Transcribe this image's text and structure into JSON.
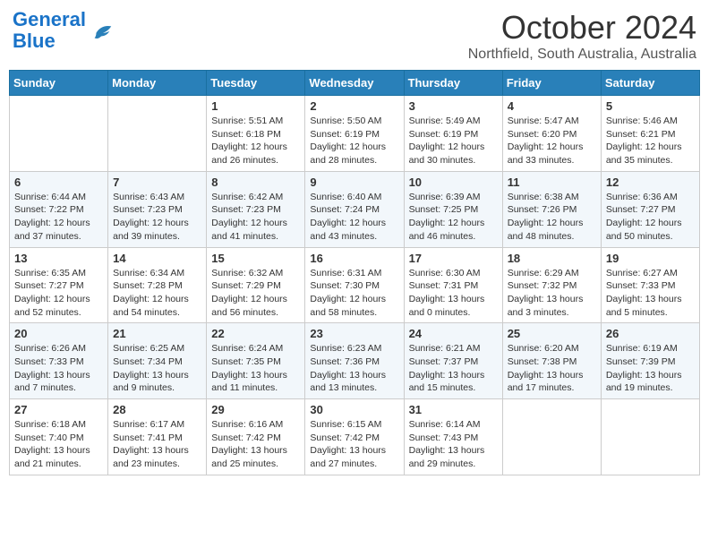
{
  "header": {
    "logo_line1": "General",
    "logo_line2": "Blue",
    "month": "October 2024",
    "location": "Northfield, South Australia, Australia"
  },
  "days_of_week": [
    "Sunday",
    "Monday",
    "Tuesday",
    "Wednesday",
    "Thursday",
    "Friday",
    "Saturday"
  ],
  "weeks": [
    [
      {
        "day": "",
        "info": ""
      },
      {
        "day": "",
        "info": ""
      },
      {
        "day": "1",
        "info": "Sunrise: 5:51 AM\nSunset: 6:18 PM\nDaylight: 12 hours and 26 minutes."
      },
      {
        "day": "2",
        "info": "Sunrise: 5:50 AM\nSunset: 6:19 PM\nDaylight: 12 hours and 28 minutes."
      },
      {
        "day": "3",
        "info": "Sunrise: 5:49 AM\nSunset: 6:19 PM\nDaylight: 12 hours and 30 minutes."
      },
      {
        "day": "4",
        "info": "Sunrise: 5:47 AM\nSunset: 6:20 PM\nDaylight: 12 hours and 33 minutes."
      },
      {
        "day": "5",
        "info": "Sunrise: 5:46 AM\nSunset: 6:21 PM\nDaylight: 12 hours and 35 minutes."
      }
    ],
    [
      {
        "day": "6",
        "info": "Sunrise: 6:44 AM\nSunset: 7:22 PM\nDaylight: 12 hours and 37 minutes."
      },
      {
        "day": "7",
        "info": "Sunrise: 6:43 AM\nSunset: 7:23 PM\nDaylight: 12 hours and 39 minutes."
      },
      {
        "day": "8",
        "info": "Sunrise: 6:42 AM\nSunset: 7:23 PM\nDaylight: 12 hours and 41 minutes."
      },
      {
        "day": "9",
        "info": "Sunrise: 6:40 AM\nSunset: 7:24 PM\nDaylight: 12 hours and 43 minutes."
      },
      {
        "day": "10",
        "info": "Sunrise: 6:39 AM\nSunset: 7:25 PM\nDaylight: 12 hours and 46 minutes."
      },
      {
        "day": "11",
        "info": "Sunrise: 6:38 AM\nSunset: 7:26 PM\nDaylight: 12 hours and 48 minutes."
      },
      {
        "day": "12",
        "info": "Sunrise: 6:36 AM\nSunset: 7:27 PM\nDaylight: 12 hours and 50 minutes."
      }
    ],
    [
      {
        "day": "13",
        "info": "Sunrise: 6:35 AM\nSunset: 7:27 PM\nDaylight: 12 hours and 52 minutes."
      },
      {
        "day": "14",
        "info": "Sunrise: 6:34 AM\nSunset: 7:28 PM\nDaylight: 12 hours and 54 minutes."
      },
      {
        "day": "15",
        "info": "Sunrise: 6:32 AM\nSunset: 7:29 PM\nDaylight: 12 hours and 56 minutes."
      },
      {
        "day": "16",
        "info": "Sunrise: 6:31 AM\nSunset: 7:30 PM\nDaylight: 12 hours and 58 minutes."
      },
      {
        "day": "17",
        "info": "Sunrise: 6:30 AM\nSunset: 7:31 PM\nDaylight: 13 hours and 0 minutes."
      },
      {
        "day": "18",
        "info": "Sunrise: 6:29 AM\nSunset: 7:32 PM\nDaylight: 13 hours and 3 minutes."
      },
      {
        "day": "19",
        "info": "Sunrise: 6:27 AM\nSunset: 7:33 PM\nDaylight: 13 hours and 5 minutes."
      }
    ],
    [
      {
        "day": "20",
        "info": "Sunrise: 6:26 AM\nSunset: 7:33 PM\nDaylight: 13 hours and 7 minutes."
      },
      {
        "day": "21",
        "info": "Sunrise: 6:25 AM\nSunset: 7:34 PM\nDaylight: 13 hours and 9 minutes."
      },
      {
        "day": "22",
        "info": "Sunrise: 6:24 AM\nSunset: 7:35 PM\nDaylight: 13 hours and 11 minutes."
      },
      {
        "day": "23",
        "info": "Sunrise: 6:23 AM\nSunset: 7:36 PM\nDaylight: 13 hours and 13 minutes."
      },
      {
        "day": "24",
        "info": "Sunrise: 6:21 AM\nSunset: 7:37 PM\nDaylight: 13 hours and 15 minutes."
      },
      {
        "day": "25",
        "info": "Sunrise: 6:20 AM\nSunset: 7:38 PM\nDaylight: 13 hours and 17 minutes."
      },
      {
        "day": "26",
        "info": "Sunrise: 6:19 AM\nSunset: 7:39 PM\nDaylight: 13 hours and 19 minutes."
      }
    ],
    [
      {
        "day": "27",
        "info": "Sunrise: 6:18 AM\nSunset: 7:40 PM\nDaylight: 13 hours and 21 minutes."
      },
      {
        "day": "28",
        "info": "Sunrise: 6:17 AM\nSunset: 7:41 PM\nDaylight: 13 hours and 23 minutes."
      },
      {
        "day": "29",
        "info": "Sunrise: 6:16 AM\nSunset: 7:42 PM\nDaylight: 13 hours and 25 minutes."
      },
      {
        "day": "30",
        "info": "Sunrise: 6:15 AM\nSunset: 7:42 PM\nDaylight: 13 hours and 27 minutes."
      },
      {
        "day": "31",
        "info": "Sunrise: 6:14 AM\nSunset: 7:43 PM\nDaylight: 13 hours and 29 minutes."
      },
      {
        "day": "",
        "info": ""
      },
      {
        "day": "",
        "info": ""
      }
    ]
  ]
}
